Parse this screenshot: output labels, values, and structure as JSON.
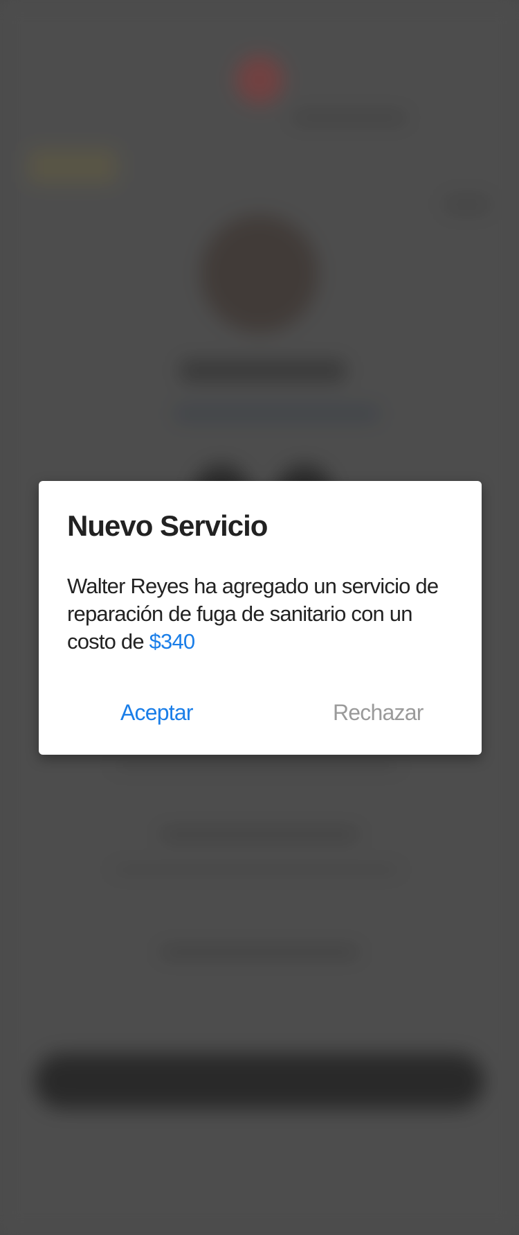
{
  "dialog": {
    "title": "Nuevo Servicio",
    "message_prefix": "Walter Reyes ha agregado un servicio de reparación de fuga de sanitario con un costo de ",
    "price": "$340",
    "accept_label": "Aceptar",
    "reject_label": "Rechazar"
  },
  "colors": {
    "accent": "#1a7ee8",
    "reject_text": "#9a9a9a",
    "overlay": "#555555"
  }
}
